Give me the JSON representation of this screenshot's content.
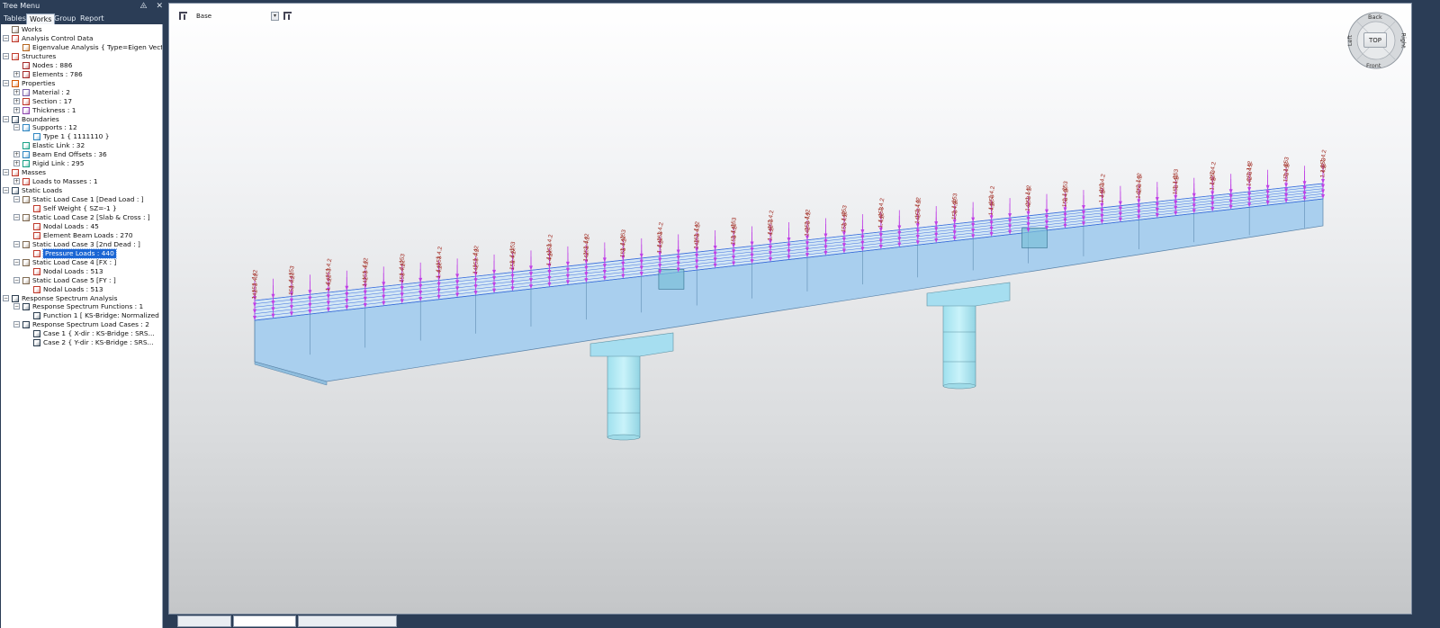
{
  "tree_menu": {
    "title": "Tree Menu",
    "pin_glyph": "⨹",
    "close_glyph": "✕",
    "tabs": [
      "Tables",
      "Works",
      "Group",
      "Report"
    ],
    "active_tab": "Works"
  },
  "tree": [
    {
      "label": "Works",
      "level": 0,
      "expander": "",
      "icon": "works-icon"
    },
    {
      "label": "Analysis Control Data",
      "level": 0,
      "expander": "−",
      "icon": "analysis-icon"
    },
    {
      "label": "Eigenvalue Analysis { Type=Eigen Vect",
      "level": 1,
      "expander": "",
      "icon": "eigen-icon"
    },
    {
      "label": "Structures",
      "level": 0,
      "expander": "−",
      "icon": "structures-icon"
    },
    {
      "label": "Nodes : 886",
      "level": 1,
      "expander": "",
      "icon": "nodes-icon"
    },
    {
      "label": "Elements : 786",
      "level": 1,
      "expander": "+",
      "icon": "elements-icon"
    },
    {
      "label": "Properties",
      "level": 0,
      "expander": "−",
      "icon": "properties-icon"
    },
    {
      "label": "Material : 2",
      "level": 1,
      "expander": "+",
      "icon": "material-icon"
    },
    {
      "label": "Section : 17",
      "level": 1,
      "expander": "+",
      "icon": "section-icon"
    },
    {
      "label": "Thickness : 1",
      "level": 1,
      "expander": "+",
      "icon": "thickness-icon"
    },
    {
      "label": "Boundaries",
      "level": 0,
      "expander": "−",
      "icon": "boundaries-icon"
    },
    {
      "label": "Supports : 12",
      "level": 1,
      "expander": "−",
      "icon": "supports-icon"
    },
    {
      "label": "Type 1 { 1111110 }",
      "level": 2,
      "expander": "",
      "icon": "support-type-icon"
    },
    {
      "label": "Elastic Link : 32",
      "level": 1,
      "expander": "",
      "icon": "elastic-link-icon"
    },
    {
      "label": "Beam End Offsets : 36",
      "level": 1,
      "expander": "+",
      "icon": "beam-offset-icon"
    },
    {
      "label": "Rigid Link : 295",
      "level": 1,
      "expander": "+",
      "icon": "rigid-link-icon"
    },
    {
      "label": "Masses",
      "level": 0,
      "expander": "−",
      "icon": "masses-icon"
    },
    {
      "label": "Loads to Masses : 1",
      "level": 1,
      "expander": "+",
      "icon": "loads-to-masses-icon"
    },
    {
      "label": "Static Loads",
      "level": 0,
      "expander": "−",
      "icon": "static-loads-icon"
    },
    {
      "label": "Static Load Case 1 [Dead Load : ]",
      "level": 1,
      "expander": "−",
      "icon": "load-case-icon"
    },
    {
      "label": "Self Weight { SZ=-1 }",
      "level": 2,
      "expander": "",
      "icon": "self-weight-icon"
    },
    {
      "label": "Static Load Case 2 [Slab & Cross : ]",
      "level": 1,
      "expander": "−",
      "icon": "load-case-icon"
    },
    {
      "label": "Nodal Loads : 45",
      "level": 2,
      "expander": "",
      "icon": "nodal-loads-icon"
    },
    {
      "label": "Element Beam Loads : 270",
      "level": 2,
      "expander": "",
      "icon": "beam-loads-icon"
    },
    {
      "label": "Static Load Case 3 [2nd Dead : ]",
      "level": 1,
      "expander": "−",
      "icon": "load-case-icon"
    },
    {
      "label": "Pressure Loads : 440",
      "level": 2,
      "expander": "",
      "icon": "pressure-loads-icon",
      "selected": true
    },
    {
      "label": "Static Load Case 4 [FX : ]",
      "level": 1,
      "expander": "−",
      "icon": "load-case-icon"
    },
    {
      "label": "Nodal Loads : 513",
      "level": 2,
      "expander": "",
      "icon": "nodal-loads-icon"
    },
    {
      "label": "Static Load Case 5 [FY : ]",
      "level": 1,
      "expander": "−",
      "icon": "load-case-icon"
    },
    {
      "label": "Nodal Loads : 513",
      "level": 2,
      "expander": "",
      "icon": "nodal-loads-icon"
    },
    {
      "label": "Response Spectrum Analysis",
      "level": 0,
      "expander": "−",
      "icon": "response-spectrum-icon"
    },
    {
      "label": "Response Spectrum Functions : 1",
      "level": 1,
      "expander": "−",
      "icon": "spectrum-function-icon"
    },
    {
      "label": "Function 1 [ KS-Bridge: Normalized",
      "level": 2,
      "expander": "",
      "icon": "spectrum-function-icon"
    },
    {
      "label": "Response Spectrum Load Cases : 2",
      "level": 1,
      "expander": "−",
      "icon": "spectrum-case-icon"
    },
    {
      "label": "Case 1 { X-dir : KS-Bridge : SRS...",
      "level": 2,
      "expander": "",
      "icon": "spectrum-case-icon"
    },
    {
      "label": "Case 2 { Y-dir : KS-Bridge : SRS...",
      "level": 2,
      "expander": "",
      "icon": "spectrum-case-icon"
    }
  ],
  "viewport": {
    "layer_value": "Base",
    "dropdown_glyph": "▾",
    "load_labels": [
      "142",
      "153",
      "1.4.2"
    ],
    "nav_cube": {
      "top": "TOP",
      "back": "Back",
      "front": "Front",
      "left": "Left",
      "right": "Right"
    }
  },
  "colors": {
    "frame": "#2b3d56",
    "selection": "#1b66d4",
    "deck": "#a9cfee",
    "pier": "#b9ecf6",
    "load_arrow": "#c040e6",
    "load_label": "#a0281e"
  }
}
